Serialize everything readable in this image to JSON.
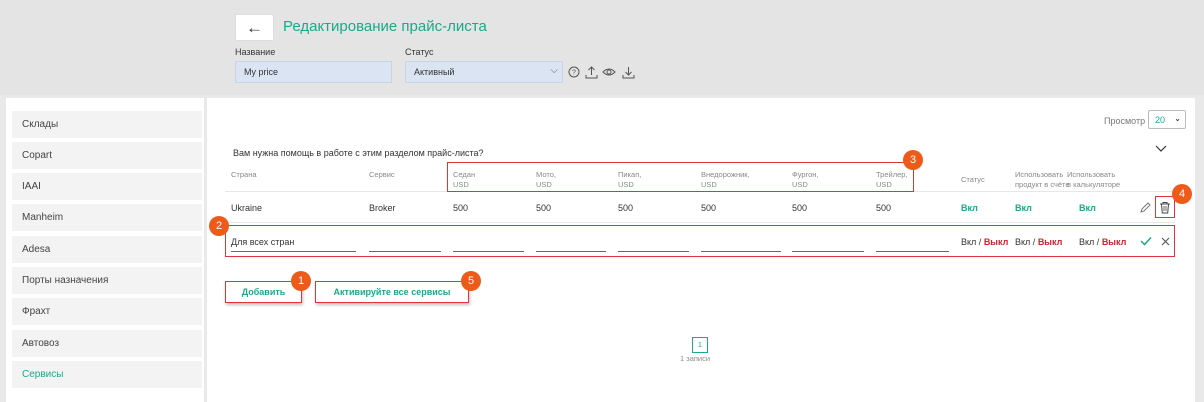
{
  "header": {
    "back_icon": "arrow-left-icon",
    "title": "Редактирование прайс-листа",
    "name_label": "Название",
    "name_value": "My price",
    "status_label": "Статус",
    "status_value": "Активный",
    "icons": [
      "help-icon",
      "upload-icon",
      "eye-icon",
      "download-icon"
    ]
  },
  "sidebar": {
    "items": [
      {
        "label": "Склады"
      },
      {
        "label": "Copart"
      },
      {
        "label": "IAAI"
      },
      {
        "label": "Manheim"
      },
      {
        "label": "Adesa"
      },
      {
        "label": "Порты назначения"
      },
      {
        "label": "Фрахт"
      },
      {
        "label": "Автовоз"
      },
      {
        "label": "Сервисы",
        "active": true
      }
    ]
  },
  "main": {
    "view_label": "Просмотр",
    "view_value": "20",
    "help_text": "Вам нужна помощь в работе с этим разделом прайс-листа?",
    "columns": {
      "country": "Страна",
      "service": "Сервис",
      "sedan": [
        "Седан",
        "USD"
      ],
      "moto": [
        "Мото,",
        "USD"
      ],
      "pickup": [
        "Пикап,",
        "USD"
      ],
      "suv": [
        "Внедорожник,",
        "USD"
      ],
      "van": [
        "Фургон,",
        "USD"
      ],
      "trailer": [
        "Трейлер,",
        "USD"
      ],
      "status": "Статус",
      "use_invoice": [
        "Использовать",
        "продукт в счёте"
      ],
      "use_calc": [
        "Использовать",
        "в калькуляторе"
      ]
    },
    "row": {
      "country": "Ukraine",
      "service": "Broker",
      "sedan": "500",
      "moto": "500",
      "pickup": "500",
      "suv": "500",
      "van": "500",
      "trailer": "500",
      "status": "Вкл",
      "use_invoice": "Вкл",
      "use_calc": "Вкл"
    },
    "new_row": {
      "country_placeholder": "Для всех стран",
      "on": "Вкл",
      "sep": " / ",
      "off": "Выкл"
    },
    "add_button": "Добавить",
    "activate_button": "Активируйте все сервисы",
    "page": "1",
    "records": "1 записи"
  },
  "markers": [
    "1",
    "2",
    "3",
    "4",
    "5"
  ],
  "colors": {
    "accent": "#1aa98a",
    "danger": "#d0232c",
    "marker": "#ee5a1a",
    "annotation": "#d9363e"
  }
}
